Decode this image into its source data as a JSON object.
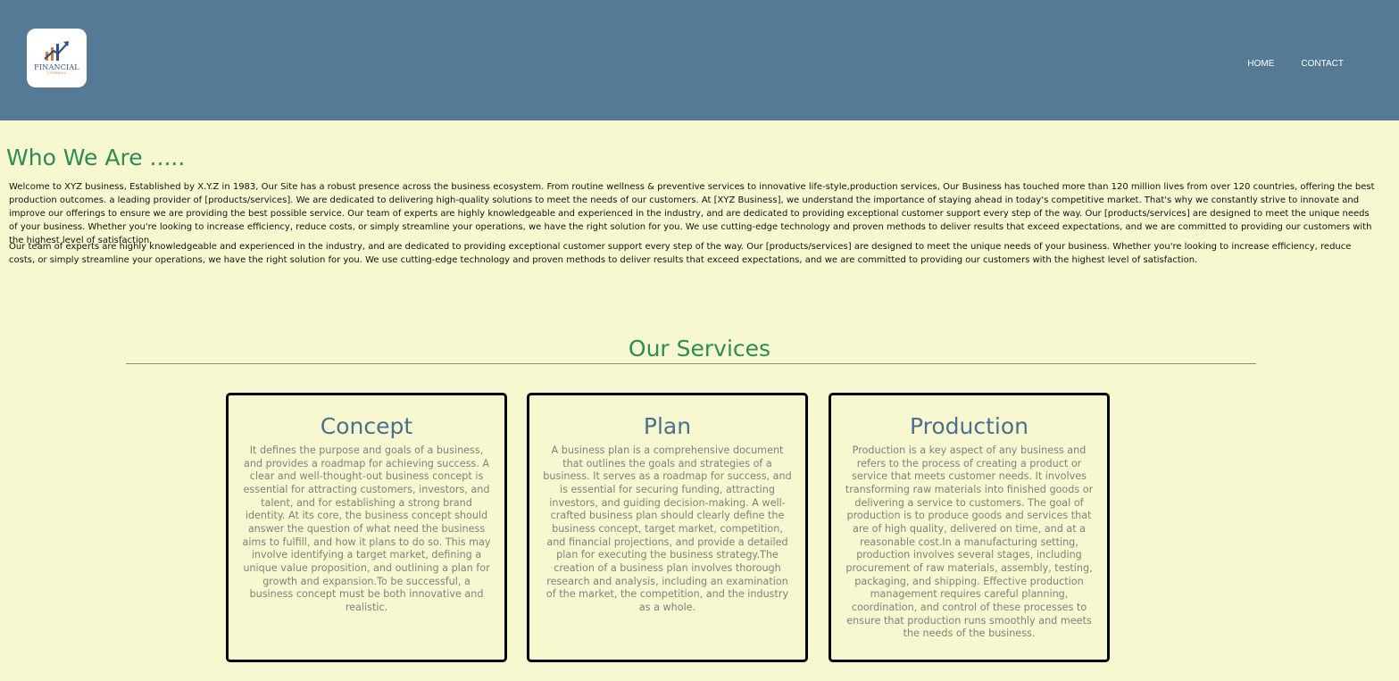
{
  "header": {
    "logo": {
      "icon": "rising-chart-logo-icon",
      "text": "FINANCIAL",
      "subtext": "COMPANY"
    },
    "nav": [
      {
        "label": "HOME"
      },
      {
        "label": "CONTACT"
      }
    ]
  },
  "about": {
    "title": "Who We Are .....",
    "paragraphs": [
      "Welcome to XYZ business, Established by X.Y.Z in 1983, Our Site has a robust presence across the business ecosystem. From routine wellness & preventive services to innovative life-style,production services, Our Business has touched more than 120 million lives from over 120 countries, offering the best production outcomes. a leading provider of [products/services]. We are dedicated to delivering high-quality solutions to meet the needs of our customers. At [XYZ Business], we understand the importance of staying ahead in today's competitive market. That's why we constantly strive to innovate and improve our offerings to ensure we are providing the best possible service. Our team of experts are highly knowledgeable and experienced in the industry, and are dedicated to providing exceptional customer support every step of the way. Our [products/services] are designed to meet the unique needs of your business. Whether you're looking to increase efficiency, reduce costs, or simply streamline your operations, we have the right solution for you. We use cutting-edge technology and proven methods to deliver results that exceed expectations, and we are committed to providing our customers with the highest level of satisfaction.",
      "Our team of experts are highly knowledgeable and experienced in the industry, and are dedicated to providing exceptional customer support every step of the way. Our [products/services] are designed to meet the unique needs of your business. Whether you're looking to increase efficiency, reduce costs, or simply streamline your operations, we have the right solution for you. We use cutting-edge technology and proven methods to deliver results that exceed expectations, and we are committed to providing our customers with the highest level of satisfaction."
    ]
  },
  "services": {
    "title": "Our Services",
    "cards": [
      {
        "title": "Concept",
        "text": "It defines the purpose and goals of a business, and provides a roadmap for achieving success. A clear and well-thought-out business concept is essential for attracting customers, investors, and talent, and for establishing a strong brand identity. At its core, the business concept should answer the question of what need the business aims to fulfill, and how it plans to do so. This may involve identifying a target market, defining a unique value proposition, and outlining a plan for growth and expansion.To be successful, a business concept must be both innovative and realistic."
      },
      {
        "title": "Plan",
        "text": "A business plan is a comprehensive document that outlines the goals and strategies of a business. It serves as a roadmap for success, and is essential for securing funding, attracting investors, and guiding decision-making. A well-crafted business plan should clearly define the business concept, target market, competition, and financial projections, and provide a detailed plan for executing the business strategy.The creation of a business plan involves thorough research and analysis, including an examination of the market, the competition, and the industry as a whole."
      },
      {
        "title": "Production",
        "text": "Production is a key aspect of any business and refers to the process of creating a product or service that meets customer needs. It involves transforming raw materials into finished goods or delivering a service to customers. The goal of production is to produce goods and services that are of high quality, delivered on time, and at a reasonable cost.In a manufacturing setting, production involves several stages, including procurement of raw materials, assembly, testing, packaging, and shipping. Effective production management requires careful planning, coordination, and control of these processes to ensure that production runs smoothly and meets the needs of the business."
      }
    ]
  },
  "colors": {
    "header_bg": "#557a96",
    "page_bg": "#f8f8d0",
    "heading_green": "#2e8b57",
    "card_title_blue": "#4a6f8f",
    "card_text_gray": "#808080"
  }
}
